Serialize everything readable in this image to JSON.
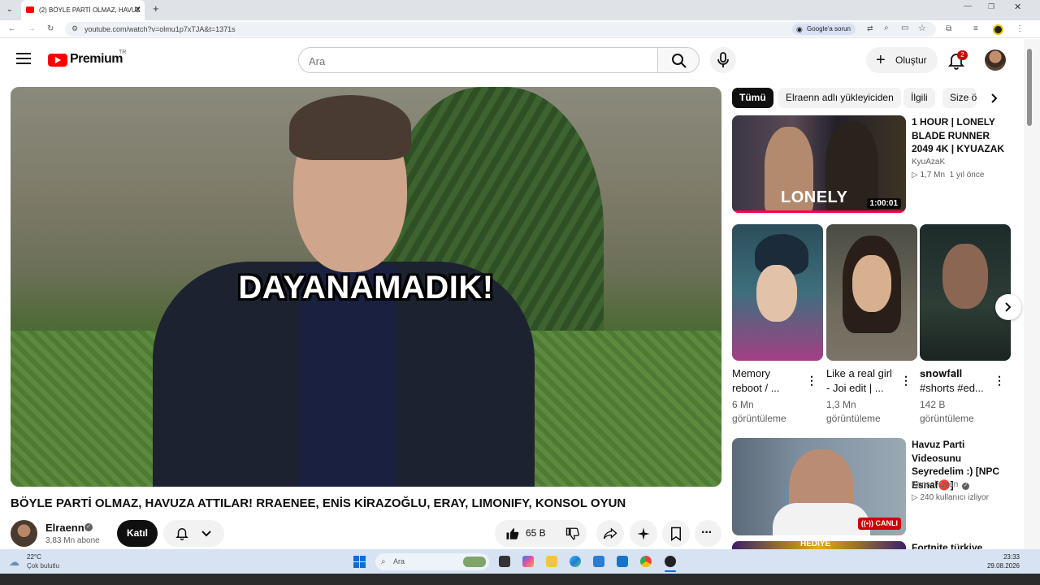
{
  "browser": {
    "tab_title": "(2) BÖYLE PARTİ OLMAZ, HAVUZ",
    "url": "youtube.com/watch?v=olmu1p7xTJA&t=1371s",
    "google_lens_label": "Google'a sorun"
  },
  "header": {
    "logo_text": "Premium",
    "logo_region": "TR",
    "search_placeholder": "Ara",
    "create_label": "Oluştur",
    "notification_count": "2"
  },
  "player": {
    "overlay_caption": "DAYANAMADIK!"
  },
  "video": {
    "title": "BÖYLE PARTİ OLMAZ, HAVUZA ATTILAR! RRAENEE, ENİS KİRAZOĞLU, ERAY, LIMONIFY, KONSOL OYUN",
    "channel_name": "Elraenn",
    "subscribers": "3,83 Mn abone",
    "join_label": "Katıl",
    "like_count": "65 B"
  },
  "sidebar": {
    "chips": [
      "Tümü",
      "Elraenn adlı yükleyiciden",
      "İlgili",
      "Size ö"
    ],
    "rec1": {
      "title": "1 HOUR | LONELY BLADE RUNNER 2049 4K | KYUAZAK",
      "channel": "KyuAzaK",
      "views": "1,7 Mn",
      "age": "1 yıl önce",
      "duration": "1:00:01",
      "thumb_text": "LONELY"
    },
    "shorts": [
      {
        "title": "Memory reboot / ...",
        "views": "6 Mn",
        "views_suffix": "görüntüleme"
      },
      {
        "title": "Like a real girl - Joi edit | ...",
        "views": "1,3 Mn",
        "views_suffix": "görüntüleme"
      },
      {
        "title": "𝐬𝐧𝐨𝐰𝐟𝐚𝐥𝐥 #shorts #ed...",
        "views": "142 B",
        "views_suffix": "görüntüleme"
      }
    ],
    "rec2": {
      "title": "Havuz Parti Videosunu Seyredelim :) [NPC Esnaf🔴]",
      "channel": "Konsol Oyun",
      "meta": "240 kullanıcı izliyor",
      "live_badge": "CANLI"
    },
    "rec3": {
      "title": "Fortnite türkiye",
      "thumb_text": "HEDİYE"
    }
  },
  "taskbar": {
    "weather_temp": "22°C",
    "weather_desc": "Çok bulutlu",
    "search_label": "Ara",
    "time": "23:33",
    "date": "29.08.2026"
  },
  "colors": {
    "brand_red": "#ff0000",
    "text_primary": "#0f0f0f",
    "text_secondary": "#606060",
    "chip_bg": "#f2f2f2"
  },
  "icons": [
    "menu-icon",
    "youtube-logo-icon",
    "search-icon",
    "mic-icon",
    "plus-icon",
    "bell-icon",
    "like-icon",
    "dislike-icon",
    "share-icon",
    "sparkle-icon",
    "save-icon",
    "more-icon",
    "chevron-right-icon",
    "verified-icon"
  ]
}
